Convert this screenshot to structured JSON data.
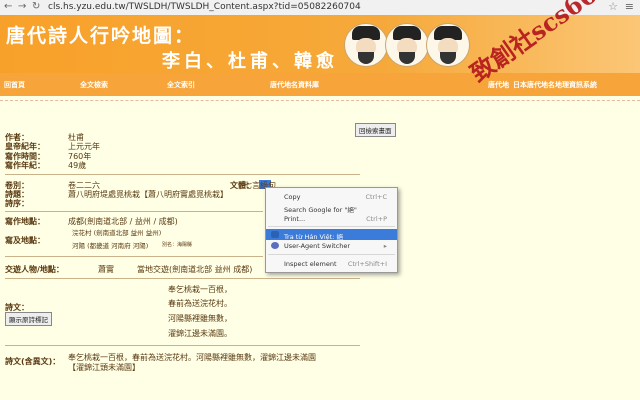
{
  "browser": {
    "url": "cls.hs.yzu.edu.tw/TWSLDH/TWSLDH_Content.aspx?tid=05082260704",
    "back_icon": "back-arrow-icon",
    "forward_icon": "forward-arrow-icon",
    "reload_icon": "reload-icon"
  },
  "banner": {
    "title1": "唐代詩人行吟地圖：",
    "title2": "李白、杜甫、韓愈",
    "jp": "日本唐代地名地理資訊系統"
  },
  "stamp": "致創社scs66",
  "nav": [
    "回首頁",
    "全文檢索",
    "全文索引",
    "唐代地名資料庫",
    "唐代地",
    "日本唐代地名地理資訊系統"
  ],
  "buttons": {
    "back_map": "回檢索畫面",
    "show_poem": "顯示原詩標記"
  },
  "fields": {
    "author_label": "作者：",
    "author": "杜甫",
    "era_label": "皇帝紀年：",
    "era": "上元元年",
    "time_label": "寫作時間：",
    "time": "760年",
    "age_label": "寫作年紀：",
    "age": "49歲",
    "volume_label": "卷別：",
    "volume": "卷二二六",
    "genre_label": "文體：",
    "genre": "七言絕句",
    "title_label": "詩題：",
    "title": "蕭八明府堤處覓桃栽【蕭八明府實處覓桃栽】",
    "preface_label": "詩序：",
    "place_label": "寫作地點：",
    "place": "成都(劍南道北部 / 益州 / 成都)",
    "mention_label": "寫及地點：",
    "mention1": "浣花村 (劍南道北部 益州 益州)",
    "mention2": "河陽 (都畿道 河南府 河陽)",
    "mention2_extra": "別名：海陽縣",
    "person_label": "交遊人物/地點：",
    "person": "蕭實",
    "person_place": "當地交遊(劍南道北部 益州 成都)",
    "poem_label": "詩文：",
    "poem_lines": [
      "奉乞桃栽一百根，",
      "春前為送浣花村。",
      "河陽縣裡雖無數，",
      "濯錦江邊未滿園。"
    ],
    "poem_full_label": "詩文(含異文)：",
    "poem_full1": "奉乞桃栽一百根，春前為送浣花村。河陽縣裡雖無數，濯錦江邊未滿園",
    "poem_full2": "【濯錦江頭未滿園】"
  },
  "context_menu": {
    "items": [
      {
        "label": "Copy",
        "shortcut": "Ctrl+C"
      },
      {
        "label": "Search Google for \"絕\"",
        "shortcut": ""
      },
      {
        "label": "Print...",
        "shortcut": "Ctrl+P"
      },
      {
        "label": "Tra từ Hán Việt: 絕",
        "shortcut": ""
      },
      {
        "label": "User-Agent Switcher",
        "shortcut": "▸"
      },
      {
        "label": "Inspect element",
        "shortcut": "Ctrl+Shift+I"
      }
    ]
  },
  "colors": {
    "banner": "#f8a12a",
    "nav": "#f7a53a",
    "page_bg": "#ffffe6",
    "stamp": "#b4181c",
    "menu_highlight": "#3b7bd9"
  }
}
